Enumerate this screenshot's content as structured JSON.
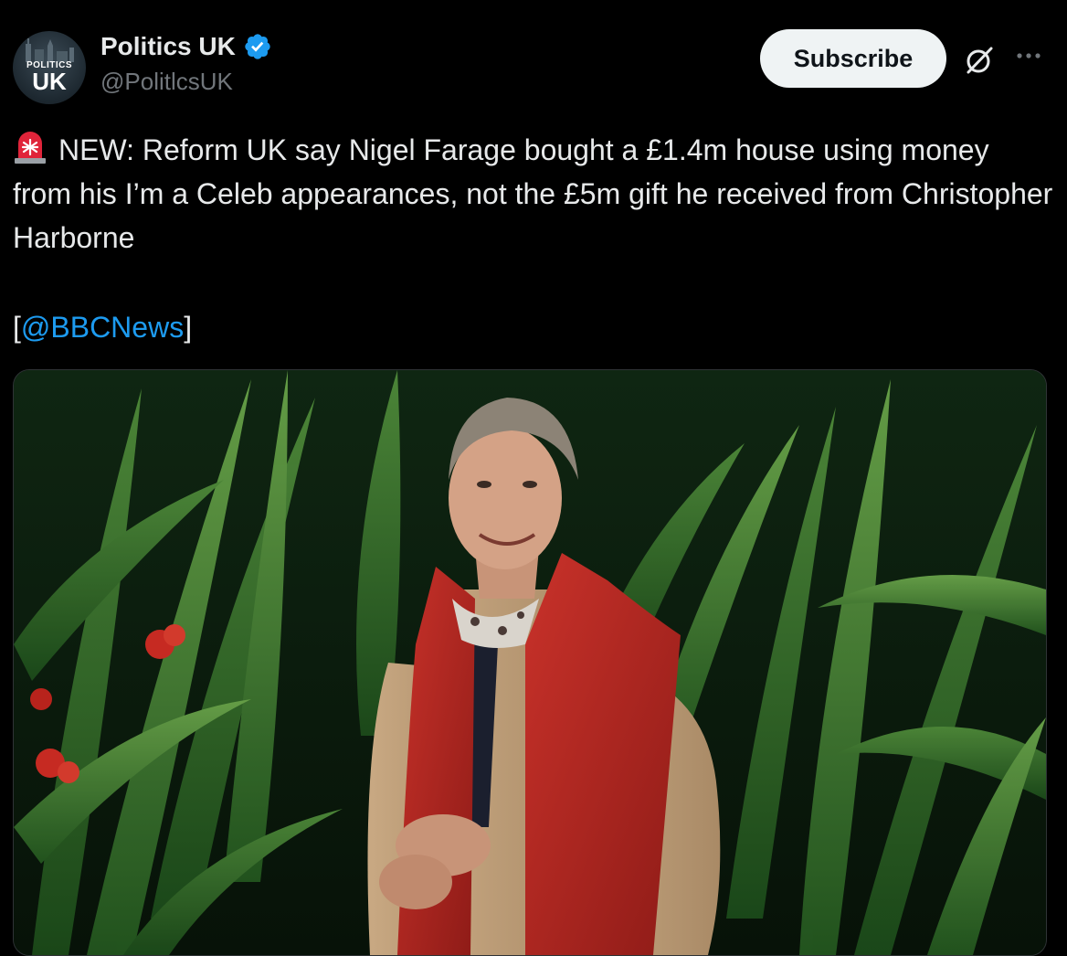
{
  "account": {
    "display_name": "Politics UK",
    "handle": "@PolitlcsUK",
    "avatar_small_text": "POLITICS",
    "avatar_big_text": "UK",
    "verified": true
  },
  "actions": {
    "subscribe_label": "Subscribe",
    "grok_icon": "grok-icon",
    "more_icon": "more-icon"
  },
  "tweet": {
    "siren_icon": "siren-icon",
    "text": "NEW: Reform UK say Nigel Farage bought a £1.4m house using money from his I’m a Celeb appearances, not the £5m gift he received from Christopher Harborne",
    "credit_open": "[",
    "credit_mention": "@BBCNews",
    "credit_close": "]"
  },
  "media": {
    "type": "photo"
  },
  "colors": {
    "background": "#000000",
    "text": "#e7e9ea",
    "secondary_text": "#71767b",
    "link": "#1d9bf0",
    "verified": "#1d9bf0",
    "subscribe_bg": "#eff3f4"
  }
}
